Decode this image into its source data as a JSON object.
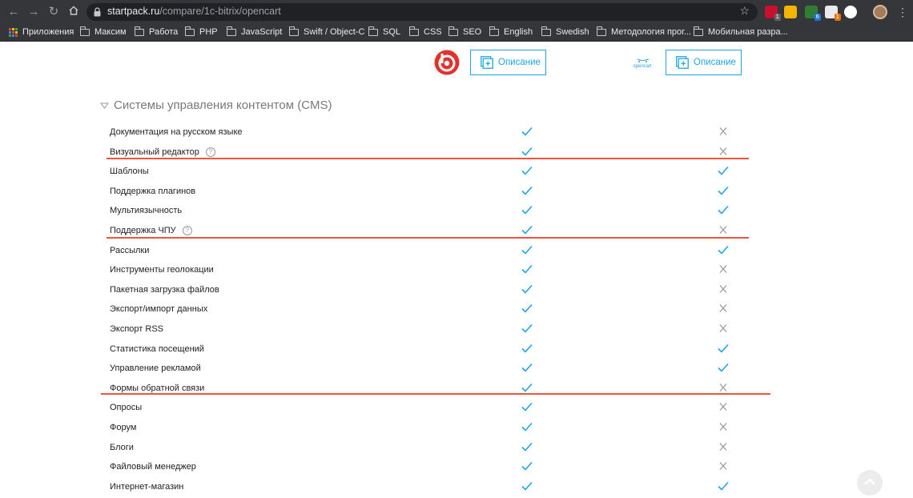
{
  "browser": {
    "url_host": "startpack.ru",
    "url_path": "/compare/1c-bitrix/opencart",
    "extensions": [
      {
        "name": "abp-icon",
        "color": "#c8102e",
        "badge": "1",
        "badge_color": "#5f6368"
      },
      {
        "name": "paw-icon",
        "color": "#f4b400",
        "badge": "",
        "badge_color": ""
      },
      {
        "name": "extension-green-icon",
        "color": "#2e7d32",
        "badge": "6",
        "badge_color": "#1a73e8"
      },
      {
        "name": "balloons-icon",
        "color": "#e8eaed",
        "badge": "1",
        "badge_color": "#e8710a"
      },
      {
        "name": "vivaldi-icon",
        "color": "#ffffff",
        "badge": "",
        "badge_color": ""
      }
    ]
  },
  "bookmarks": [
    {
      "label": "Приложения",
      "type": "apps"
    },
    {
      "label": "Максим",
      "type": "folder"
    },
    {
      "label": "Работа",
      "type": "folder"
    },
    {
      "label": "PHP",
      "type": "folder"
    },
    {
      "label": "JavaScript",
      "type": "folder"
    },
    {
      "label": "Swift / Object-C",
      "type": "folder"
    },
    {
      "label": "SQL",
      "type": "folder"
    },
    {
      "label": "CSS",
      "type": "folder"
    },
    {
      "label": "SEO",
      "type": "folder"
    },
    {
      "label": "English",
      "type": "folder"
    },
    {
      "label": "Swedish",
      "type": "folder"
    },
    {
      "label": "Методология прог...",
      "type": "folder"
    },
    {
      "label": "Мобильная разра...",
      "type": "folder"
    }
  ],
  "products": {
    "left": {
      "logo": "bitrix-logo",
      "button": "Описание"
    },
    "right": {
      "logo": "opencart-logo",
      "logo_text": "opencart",
      "button": "Описание"
    }
  },
  "section": {
    "title": "Системы управления контентом (CMS)",
    "rows": [
      {
        "label": "Документация на русском языке",
        "help": false,
        "left": true,
        "right": false
      },
      {
        "label": "Визуальный редактор",
        "help": true,
        "left": true,
        "right": false
      },
      {
        "label": "Шаблоны",
        "help": false,
        "left": true,
        "right": true
      },
      {
        "label": "Поддержка плагинов",
        "help": false,
        "left": true,
        "right": true
      },
      {
        "label": "Мультиязычность",
        "help": false,
        "left": true,
        "right": true
      },
      {
        "label": "Поддержка ЧПУ",
        "help": true,
        "left": true,
        "right": false
      },
      {
        "label": "Рассылки",
        "help": false,
        "left": true,
        "right": true
      },
      {
        "label": "Инструменты геолокации",
        "help": false,
        "left": true,
        "right": false
      },
      {
        "label": "Пакетная загрузка файлов",
        "help": false,
        "left": true,
        "right": false
      },
      {
        "label": "Экспорт/импорт данных",
        "help": false,
        "left": true,
        "right": false
      },
      {
        "label": "Экспорт RSS",
        "help": false,
        "left": true,
        "right": false
      },
      {
        "label": "Статистика посещений",
        "help": false,
        "left": true,
        "right": true
      },
      {
        "label": "Управление рекламой",
        "help": false,
        "left": true,
        "right": true
      },
      {
        "label": "Формы обратной связи",
        "help": false,
        "left": true,
        "right": false
      },
      {
        "label": "Опросы",
        "help": false,
        "left": true,
        "right": false
      },
      {
        "label": "Форум",
        "help": false,
        "left": true,
        "right": false
      },
      {
        "label": "Блоги",
        "help": false,
        "left": true,
        "right": false
      },
      {
        "label": "Файловый менеджер",
        "help": false,
        "left": true,
        "right": false
      },
      {
        "label": "Интернет-магазин",
        "help": false,
        "left": true,
        "right": true
      }
    ]
  },
  "colors": {
    "accent": "#1ea7e1",
    "check": "#1ea7e1",
    "cross": "#9a9a9a",
    "annotation": "#f0553a"
  }
}
